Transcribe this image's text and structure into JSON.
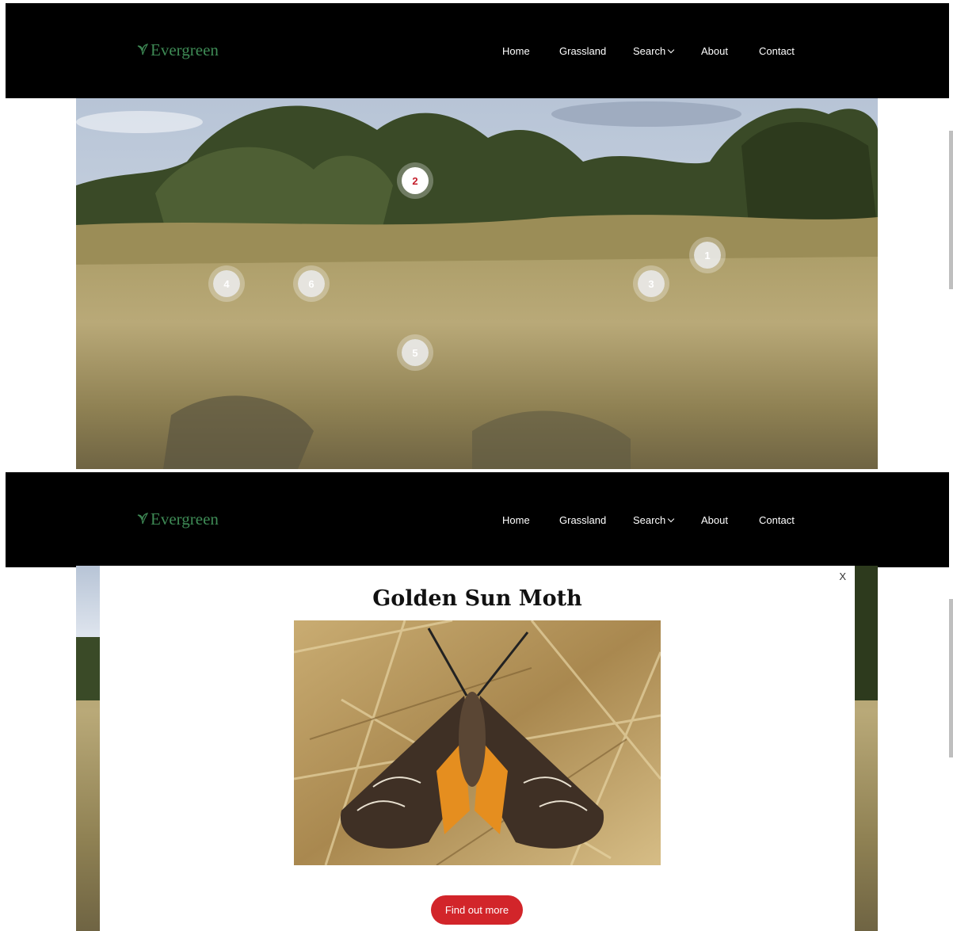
{
  "nav": {
    "logo": "Evergreen",
    "items": [
      "Home",
      "Grassland",
      "Search",
      "About",
      "Contact"
    ]
  },
  "hotspots": [
    {
      "label": "1",
      "active": false
    },
    {
      "label": "2",
      "active": true
    },
    {
      "label": "3",
      "active": false
    },
    {
      "label": "4",
      "active": false
    },
    {
      "label": "5",
      "active": false
    },
    {
      "label": "6",
      "active": false
    }
  ],
  "modal": {
    "close": "X",
    "title": "Golden Sun Moth",
    "button": "Find out more"
  },
  "colors": {
    "navbar": "#000000",
    "logo": "#3e8a55",
    "accent": "#d2252a",
    "active_hotspot_text": "#c41e2b"
  },
  "icons": {
    "logo": "leaf-icon",
    "search_dropdown": "chevron-down-icon"
  }
}
